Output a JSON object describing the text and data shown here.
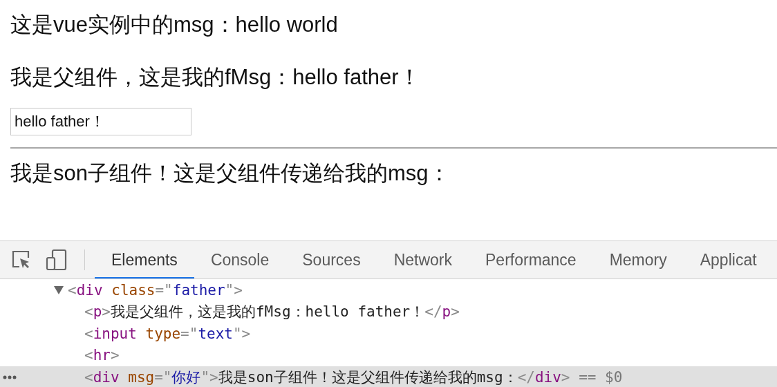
{
  "page": {
    "messages": [
      "这是vue实例中的msg：hello world",
      "我是父组件，这是我的fMsg：hello father！"
    ],
    "input": {
      "value": "hello father！"
    },
    "child_message": "我是son子组件！这是父组件传递给我的msg："
  },
  "devtools": {
    "tabs": [
      {
        "label": "Elements",
        "selected": true
      },
      {
        "label": "Console",
        "selected": false
      },
      {
        "label": "Sources",
        "selected": false
      },
      {
        "label": "Network",
        "selected": false
      },
      {
        "label": "Performance",
        "selected": false
      },
      {
        "label": "Memory",
        "selected": false
      },
      {
        "label": "Applicat",
        "selected": false
      }
    ],
    "tree": [
      {
        "expanded": true,
        "selected": false,
        "tokens": [
          {
            "kind": "bracket",
            "text": "<"
          },
          {
            "kind": "tag",
            "text": "div"
          },
          {
            "kind": "attr",
            "text": " class"
          },
          {
            "kind": "bracket",
            "text": "=\""
          },
          {
            "kind": "value",
            "text": "father"
          },
          {
            "kind": "bracket",
            "text": "\">"
          }
        ],
        "children": [
          {
            "selected": false,
            "tokens": [
              {
                "kind": "bracket",
                "text": "<"
              },
              {
                "kind": "tag",
                "text": "p"
              },
              {
                "kind": "bracket",
                "text": ">"
              },
              {
                "kind": "text",
                "text": "我是父组件，这是我的fMsg：hello father！"
              },
              {
                "kind": "bracket",
                "text": "</"
              },
              {
                "kind": "tag",
                "text": "p"
              },
              {
                "kind": "bracket",
                "text": ">"
              }
            ]
          },
          {
            "selected": false,
            "tokens": [
              {
                "kind": "bracket",
                "text": "<"
              },
              {
                "kind": "tag",
                "text": "input"
              },
              {
                "kind": "attr",
                "text": " type"
              },
              {
                "kind": "bracket",
                "text": "=\""
              },
              {
                "kind": "value",
                "text": "text"
              },
              {
                "kind": "bracket",
                "text": "\">"
              }
            ]
          },
          {
            "selected": false,
            "tokens": [
              {
                "kind": "bracket",
                "text": "<"
              },
              {
                "kind": "tag",
                "text": "hr"
              },
              {
                "kind": "bracket",
                "text": ">"
              }
            ]
          },
          {
            "selected": true,
            "tokens": [
              {
                "kind": "bracket",
                "text": "<"
              },
              {
                "kind": "tag",
                "text": "div"
              },
              {
                "kind": "attr",
                "text": " msg"
              },
              {
                "kind": "bracket",
                "text": "=\""
              },
              {
                "kind": "value",
                "text": "你好"
              },
              {
                "kind": "bracket",
                "text": "\">"
              },
              {
                "kind": "text",
                "text": "我是son子组件！这是父组件传递给我的msg："
              },
              {
                "kind": "bracket",
                "text": "</"
              },
              {
                "kind": "tag",
                "text": "div"
              },
              {
                "kind": "bracket",
                "text": ">"
              },
              {
                "kind": "ref",
                "text": " == $0"
              }
            ]
          }
        ]
      }
    ]
  }
}
